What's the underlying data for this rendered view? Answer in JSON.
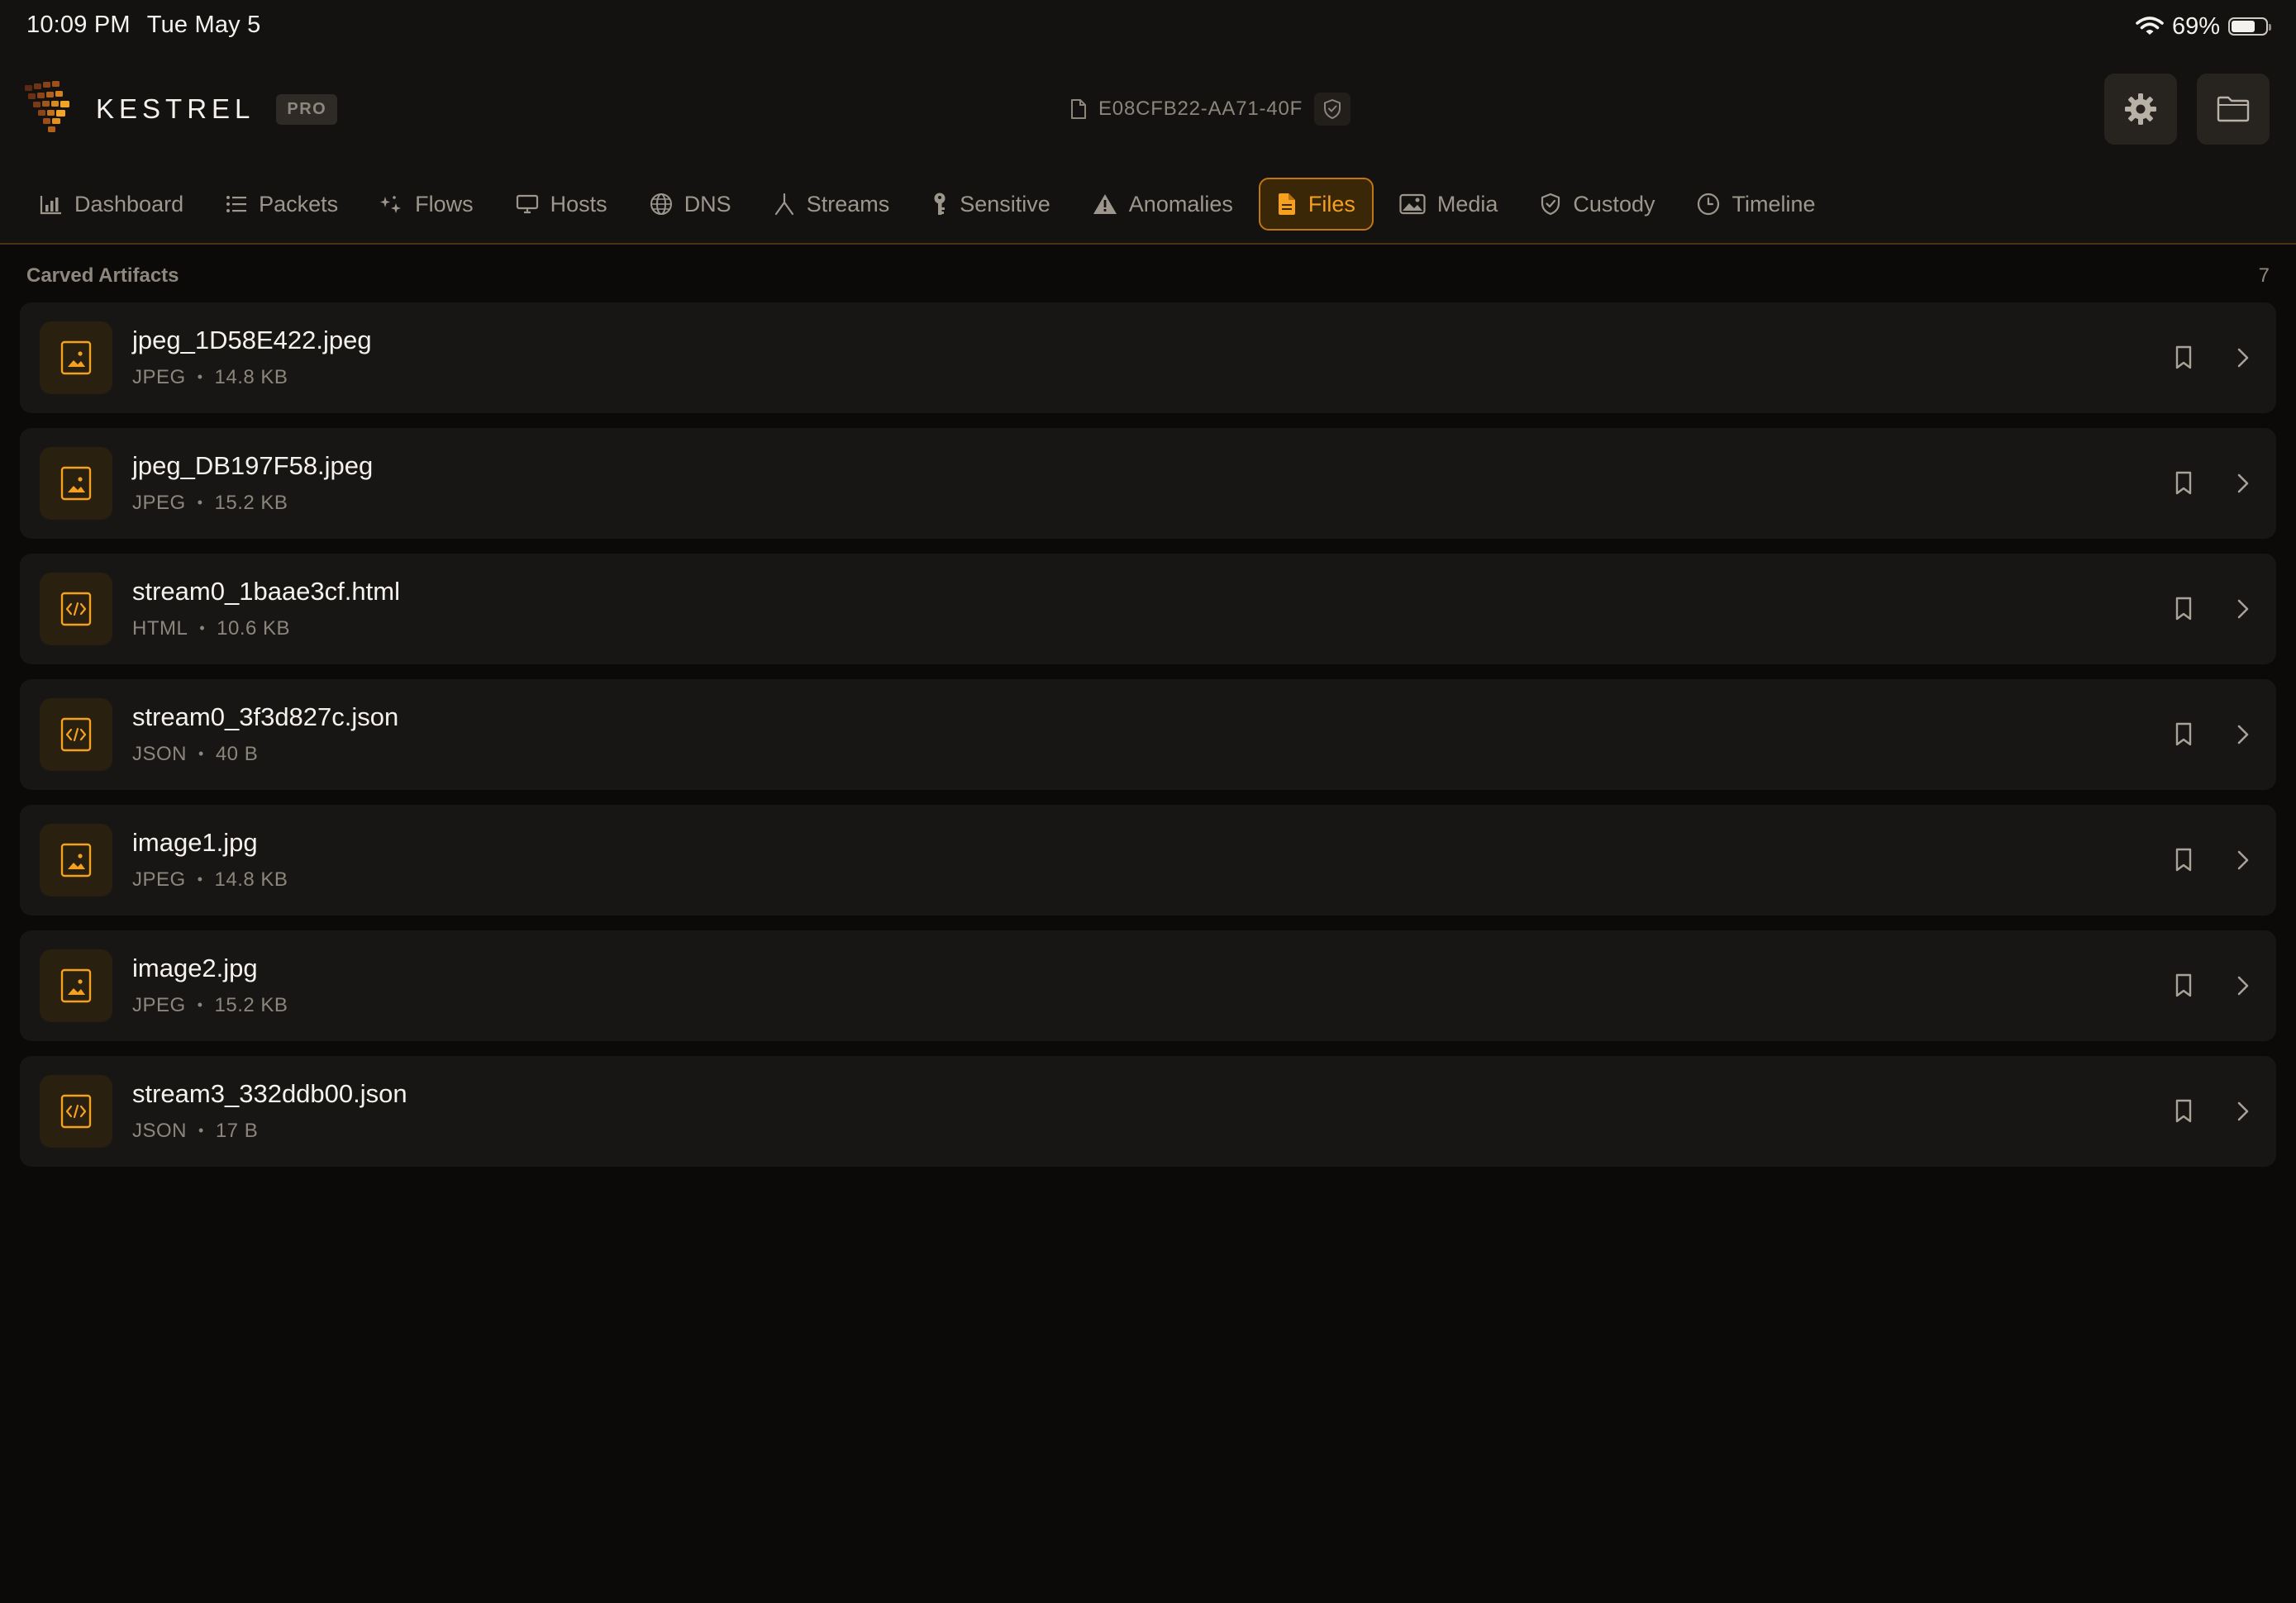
{
  "status_bar": {
    "time": "10:09 PM",
    "date": "Tue May 5",
    "battery_text": "69%",
    "battery_level": 0.69
  },
  "header": {
    "brand_name": "KESTREL",
    "badge": "PRO",
    "session_id": "E08CFB22-AA71-40F",
    "icons": {
      "settings": "gear-icon",
      "open": "folder-icon"
    }
  },
  "tabs": [
    {
      "label": "Dashboard",
      "icon": "bar-chart-icon",
      "active": false
    },
    {
      "label": "Packets",
      "icon": "list-icon",
      "active": false
    },
    {
      "label": "Flows",
      "icon": "sparkle-icon",
      "active": false
    },
    {
      "label": "Hosts",
      "icon": "monitor-icon",
      "active": false
    },
    {
      "label": "DNS",
      "icon": "globe-icon",
      "active": false
    },
    {
      "label": "Streams",
      "icon": "fork-icon",
      "active": false
    },
    {
      "label": "Sensitive",
      "icon": "key-icon",
      "active": false
    },
    {
      "label": "Anomalies",
      "icon": "warning-icon",
      "active": false
    },
    {
      "label": "Files",
      "icon": "document-icon",
      "active": true
    },
    {
      "label": "Media",
      "icon": "photo-icon",
      "active": false
    },
    {
      "label": "Custody",
      "icon": "shield-check-icon",
      "active": false
    },
    {
      "label": "Timeline",
      "icon": "clock-icon",
      "active": false
    }
  ],
  "section": {
    "title": "Carved Artifacts",
    "count": "7"
  },
  "files": [
    {
      "name": "jpeg_1D58E422.jpeg",
      "type": "JPEG",
      "size": "14.8 KB",
      "icon": "image-file-icon"
    },
    {
      "name": "jpeg_DB197F58.jpeg",
      "type": "JPEG",
      "size": "15.2 KB",
      "icon": "image-file-icon"
    },
    {
      "name": "stream0_1baae3cf.html",
      "type": "HTML",
      "size": "10.6 KB",
      "icon": "code-file-icon"
    },
    {
      "name": "stream0_3f3d827c.json",
      "type": "JSON",
      "size": "40 B",
      "icon": "code-file-icon"
    },
    {
      "name": "image1.jpg",
      "type": "JPEG",
      "size": "14.8 KB",
      "icon": "image-file-icon"
    },
    {
      "name": "image2.jpg",
      "type": "JPEG",
      "size": "15.2 KB",
      "icon": "image-file-icon"
    },
    {
      "name": "stream3_332ddb00.json",
      "type": "JSON",
      "size": "17 B",
      "icon": "code-file-icon"
    }
  ],
  "colors": {
    "accent": "#f6a020",
    "background": "#0b0a09",
    "card": "#181614",
    "muted_text": "#8b857c"
  }
}
